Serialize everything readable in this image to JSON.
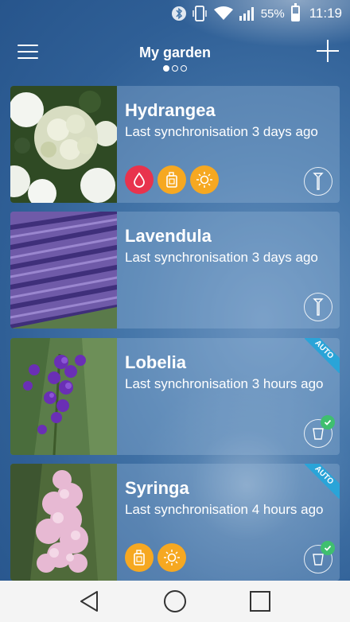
{
  "status_bar": {
    "battery_percent": "55%",
    "time": "11:19",
    "icons": [
      "bluetooth-icon",
      "vibrate-icon",
      "wifi-icon",
      "signal-icon",
      "battery-icon"
    ]
  },
  "app_bar": {
    "title": "My garden",
    "page_dots": 3,
    "active_dot": 0,
    "menu_icon": "hamburger-menu-icon",
    "add_icon": "plus-icon"
  },
  "plants": [
    {
      "name": "Hydrangea",
      "sync": "Last synchronisation 3 days ago",
      "alerts": [
        "water",
        "fertilizer",
        "light"
      ],
      "sensor": "probe-sensor-icon",
      "auto": false
    },
    {
      "name": "Lavendula",
      "sync": "Last synchronisation 3 days ago",
      "alerts": [],
      "sensor": "probe-sensor-icon",
      "auto": false
    },
    {
      "name": "Lobelia",
      "sync": "Last synchronisation 3 hours ago",
      "alerts": [],
      "sensor": "pot-sensor-icon",
      "auto": true,
      "auto_label": "AUTO"
    },
    {
      "name": "Syringa",
      "sync": "Last synchronisation 4 hours ago",
      "alerts": [
        "fertilizer",
        "light"
      ],
      "sensor": "pot-sensor-icon",
      "auto": true,
      "auto_label": "AUTO"
    }
  ],
  "colors": {
    "water_alert": "#e8334d",
    "fertilizer_alert": "#f6a821",
    "light_alert": "#f6a821",
    "auto_ribbon": "#2aa4d8",
    "check": "#3fbf6f"
  },
  "nav_bar": {
    "icons": [
      "back-icon",
      "home-icon",
      "recents-icon"
    ]
  }
}
